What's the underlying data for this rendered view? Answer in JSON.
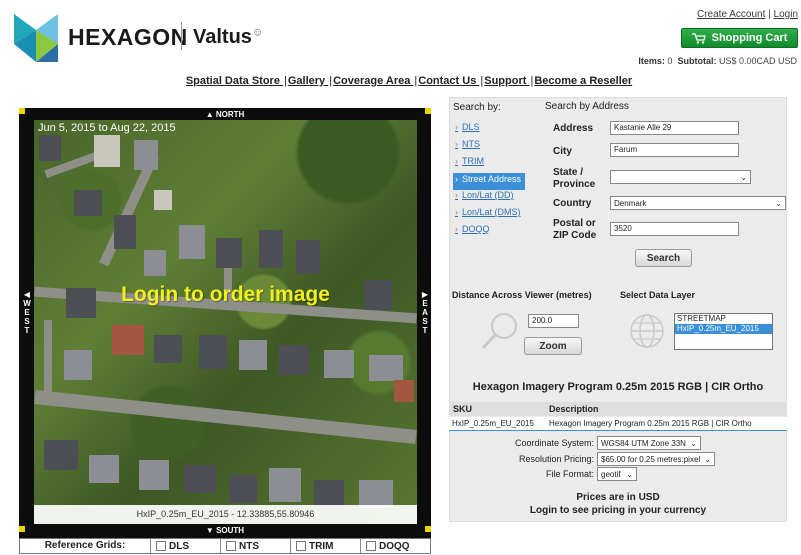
{
  "header": {
    "brand_primary": "HEXAGON",
    "brand_secondary": "Valtus",
    "account": {
      "create_account": "Create Account",
      "separator": "|",
      "login": "Login"
    },
    "cart": {
      "label": "Shopping Cart",
      "items_label": "Items:",
      "items_count": "0",
      "subtotal_label": "Subtotal:",
      "subtotal_value": "US$ 0.00CAD USD"
    }
  },
  "nav": {
    "items": [
      {
        "label": "Spatial Data Store "
      },
      {
        "label": "Gallery "
      },
      {
        "label": "Coverage Area "
      },
      {
        "label": "Contact Us "
      },
      {
        "label": "Support "
      },
      {
        "label": "Become a Reseller"
      }
    ],
    "separator": "|"
  },
  "viewer": {
    "date_range": "Jun 5, 2015 to Aug 22, 2015",
    "overlay_text": "Login to order image",
    "caption": "HxIP_0.25m_EU_2015 - 12.33885,55.80946",
    "north": "▲ NORTH",
    "south": "▼ SOUTH",
    "west": "◀ W E S T",
    "east": "▶ E A S T",
    "reference_grids": {
      "label": "Reference Grids:",
      "options": [
        "DLS",
        "NTS",
        "TRIM",
        "DOQQ"
      ]
    }
  },
  "search": {
    "search_by_label": "Search by:",
    "section_title": "Search by Address",
    "methods": [
      {
        "label": "DLS",
        "active": false
      },
      {
        "label": "NTS",
        "active": false
      },
      {
        "label": "TRIM",
        "active": false
      },
      {
        "label": "Street Address",
        "active": true
      },
      {
        "label": "Lon/Lat (DD)",
        "active": false
      },
      {
        "label": "Lon/Lat (DMS)",
        "active": false
      },
      {
        "label": "DOQQ",
        "active": false
      }
    ],
    "fields": {
      "address": {
        "label": "Address",
        "value": "Kastanie Alle 29"
      },
      "city": {
        "label": "City",
        "value": "Farum"
      },
      "state": {
        "label_line1": "State /",
        "label_line2": "Province",
        "value": ""
      },
      "country": {
        "label": "Country",
        "value": "Denmark"
      },
      "postal": {
        "label_line1": "Postal or",
        "label_line2": "ZIP Code",
        "value": "3520"
      }
    },
    "search_button": "Search"
  },
  "distance": {
    "label": "Distance Across Viewer (metres)",
    "value": "200.0",
    "zoom_button": "Zoom"
  },
  "layers": {
    "label": "Select Data Layer",
    "options": [
      {
        "label": "STREETMAP",
        "selected": false
      },
      {
        "label": "HxIP_0.25m_EU_2015",
        "selected": true
      }
    ]
  },
  "product": {
    "title": "Hexagon Imagery Program 0.25m 2015 RGB | CIR Ortho",
    "table": {
      "headers": [
        "SKU",
        "Description"
      ],
      "rows": [
        [
          "HxIP_0.25m_EU_2015",
          "Hexagon Imagery Program 0.25m 2015 RGB | CIR Ortho"
        ]
      ]
    },
    "options": {
      "coordinate_system": {
        "label": "Coordinate System:",
        "value": "WGS84 UTM Zone 33N"
      },
      "resolution_pricing": {
        "label": "Resolution Pricing:",
        "value": "$65.00 for 0.25 metres:pixel"
      },
      "file_format": {
        "label": "File Format:",
        "value": "geotif"
      }
    },
    "price_note_line1": "Prices are in USD",
    "price_note_line2": "Login to see pricing in your currency"
  },
  "colors": {
    "cart_green": "#1f9c3a",
    "link_blue": "#2f6fb3",
    "selection_blue": "#3b8fd9",
    "overlay_yellow": "#f2ef1e",
    "logo_teal": "#1fa8b8",
    "logo_green": "#8dc63f"
  },
  "icons": [
    "hexagon-logo-icon",
    "shopping-cart-icon",
    "magnifier-icon",
    "globe-icon",
    "checkbox-icon",
    "chevron-down-icon",
    "arrow-right-icon"
  ]
}
